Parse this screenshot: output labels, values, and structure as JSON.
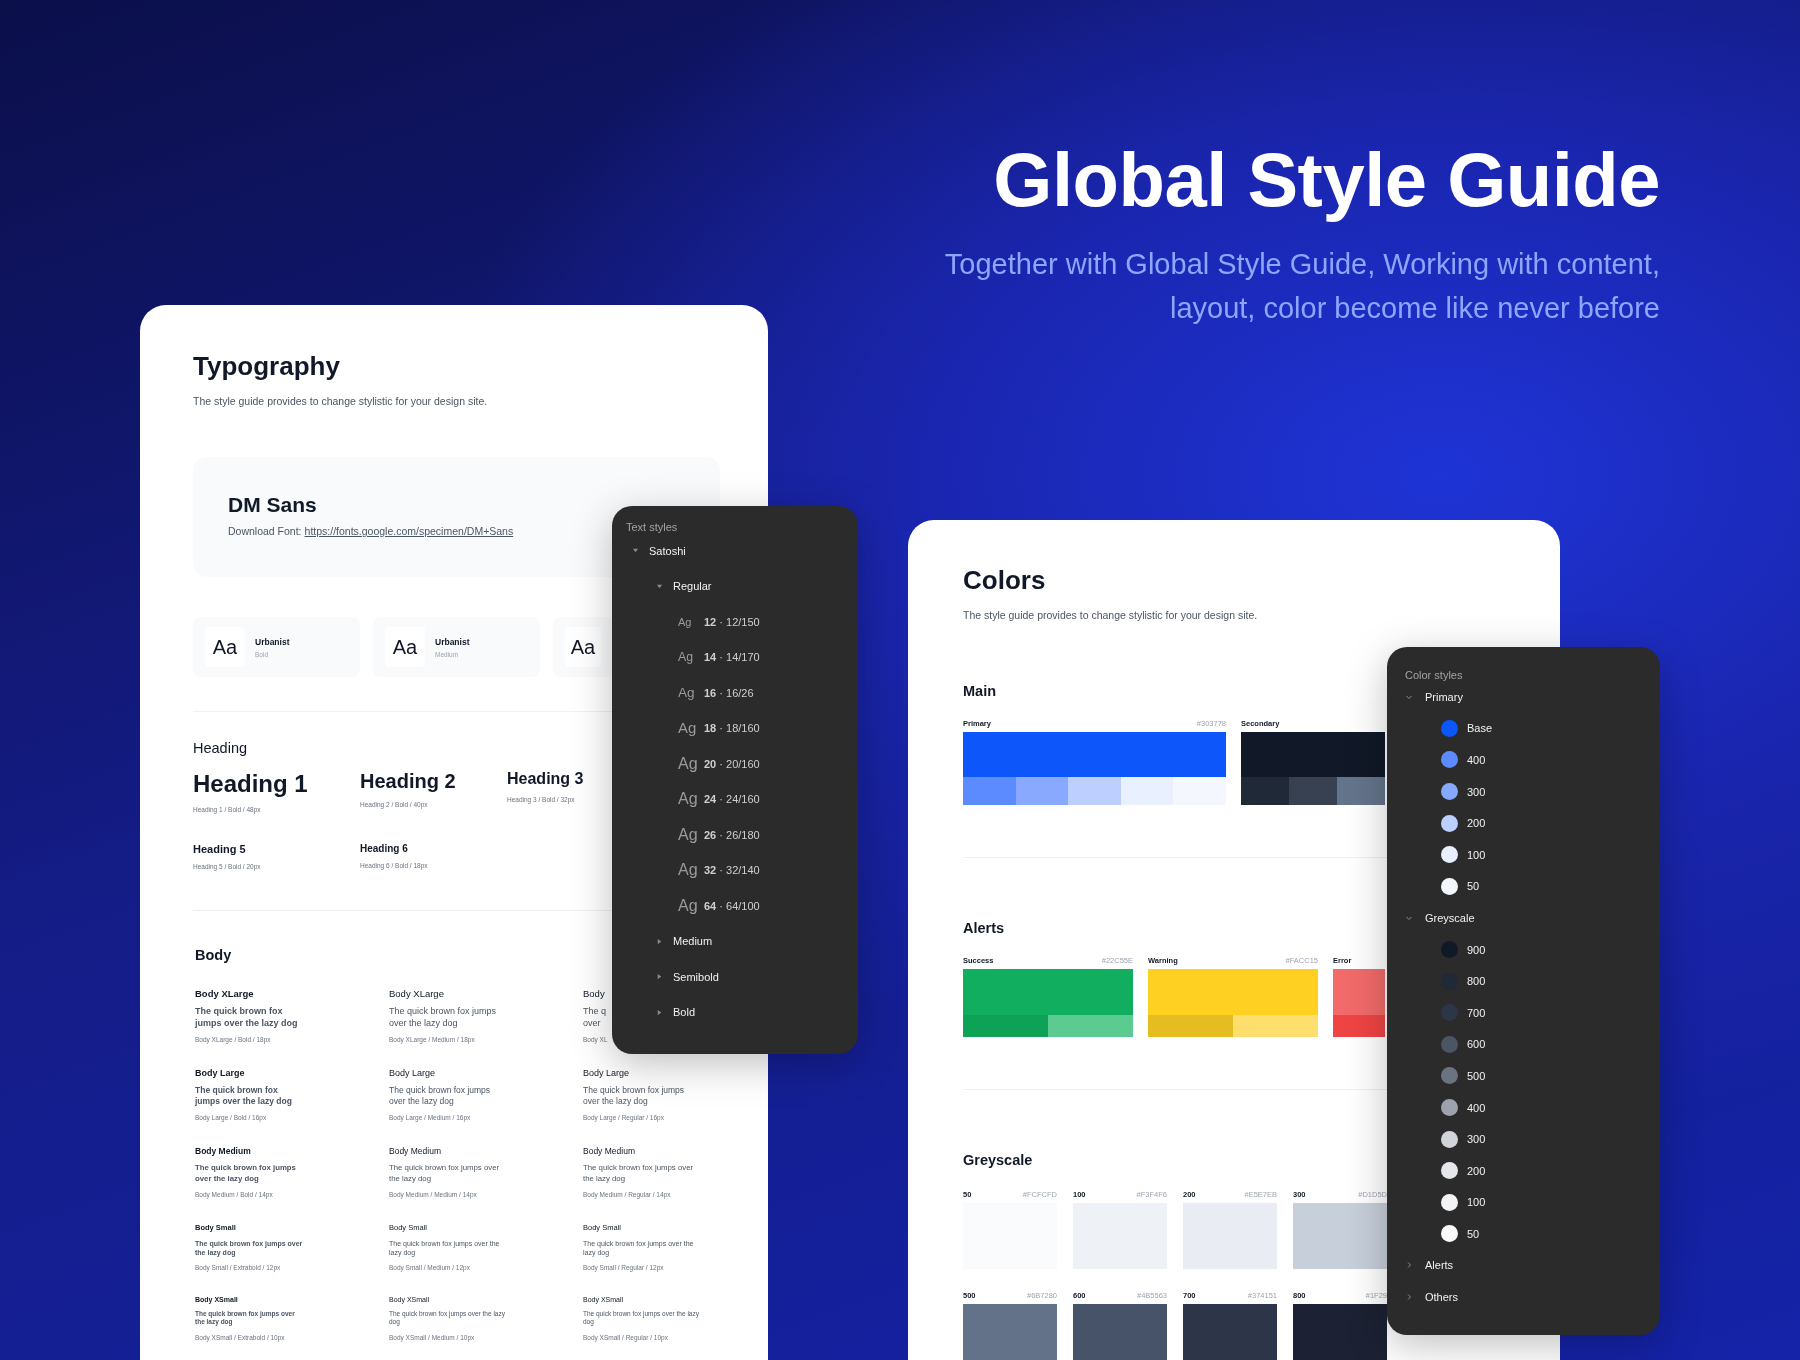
{
  "hero": {
    "title": "Global Style Guide",
    "subtitle_lines": [
      "Together with Global Style Guide, Working with content,",
      "layout, color become like never before"
    ]
  },
  "typography": {
    "title": "Typography",
    "description": "The style guide provides to change stylistic for your design site.",
    "font": {
      "name": "DM Sans",
      "download_label": "Download Font:",
      "link": "https://fonts.google.com/specimen/DM+Sans"
    },
    "font_tiles": [
      {
        "sample": "Aa",
        "family": "Urbanist",
        "weight": "Bold"
      },
      {
        "sample": "Aa",
        "family": "Urbanist",
        "weight": "Medium"
      },
      {
        "sample": "Aa"
      }
    ],
    "heading_section": {
      "title": "Heading",
      "rows": [
        [
          {
            "kind": "h1",
            "label": "Heading 1",
            "spec": "Heading 1 / Bold / 48px"
          },
          {
            "kind": "h2",
            "label": "Heading 2",
            "spec": "Heading 2 / Bold / 40px"
          },
          {
            "kind": "h3",
            "label": "Heading 3",
            "spec": "Heading 3 / Bold / 32px"
          }
        ],
        [
          {
            "kind": "h5",
            "label": "Heading 5",
            "spec": "Heading 5 / Bold / 20px"
          },
          {
            "kind": "h6",
            "label": "Heading 6",
            "spec": "Heading 6 / Bold / 18px"
          }
        ]
      ]
    },
    "body_section": {
      "title": "Body",
      "rows": [
        [
          {
            "kind": "xlarge",
            "label": "Body XLarge",
            "sample": "The quick brown fox jumps over the lazy dog",
            "spec": "Body XLarge / Bold / 18px"
          },
          {
            "kind": "xlarge",
            "label": "Body XLarge",
            "sample": "The quick brown fox jumps over the lazy dog",
            "spec": "Body XLarge / Medium / 18px"
          },
          {
            "kind": "xlarge",
            "label": "Body",
            "sample": "The q\nover",
            "spec": "Body XL"
          }
        ],
        [
          {
            "kind": "large",
            "label": "Body Large",
            "sample": "The quick brown fox jumps over the lazy dog",
            "spec": "Body Large / Bold / 16px"
          },
          {
            "kind": "large",
            "label": "Body Large",
            "sample": "The quick brown fox jumps over the lazy dog",
            "spec": "Body Large / Medium / 16px"
          },
          {
            "kind": "large",
            "label": "Body Large",
            "sample": "The quick brown fox jumps over the lazy dog",
            "spec": "Body Large / Regular / 16px"
          }
        ],
        [
          {
            "kind": "medium",
            "label": "Body Medium",
            "sample": "The quick brown fox jumps over the lazy dog",
            "spec": "Body Medium / Bold / 14px"
          },
          {
            "kind": "medium",
            "label": "Body Medium",
            "sample": "The quick brown fox jumps over the lazy dog",
            "spec": "Body Medium / Medium / 14px"
          },
          {
            "kind": "medium",
            "label": "Body Medium",
            "sample": "The quick brown fox jumps over the lazy dog",
            "spec": "Body Medium / Regular / 14px"
          }
        ],
        [
          {
            "kind": "small",
            "label": "Body Small",
            "sample": "The quick brown fox jumps over the lazy dog",
            "spec": "Body Small / Extrabold / 12px"
          },
          {
            "kind": "small",
            "label": "Body Small",
            "sample": "The quick brown fox jumps over the lazy dog",
            "spec": "Body Small / Medium / 12px"
          },
          {
            "kind": "small",
            "label": "Body Small",
            "sample": "The quick brown fox jumps over the lazy dog",
            "spec": "Body Small / Regular / 12px"
          }
        ],
        [
          {
            "kind": "xsmall",
            "label": "Body XSmall",
            "sample": "The quick brown fox jumps over the lazy dog",
            "spec": "Body XSmall / Extrabold / 10px"
          },
          {
            "kind": "xsmall",
            "label": "Body XSmall",
            "sample": "The quick brown fox jumps over the lazy dog",
            "spec": "Body XSmall / Medium / 10px"
          },
          {
            "kind": "xsmall",
            "label": "Body XSmall",
            "sample": "The quick brown fox jumps over the lazy dog",
            "spec": "Body XSmall / Regular / 10px"
          }
        ]
      ]
    }
  },
  "text_styles": {
    "title": "Text styles",
    "tree": [
      {
        "label": "Satoshi",
        "expanded": true,
        "children": [
          {
            "label": "Regular",
            "expanded": true,
            "children": [
              {
                "sample": "Ag",
                "label": "**12** · 12/150"
              },
              {
                "sample": "Ag",
                "label": "**14** · 14/170"
              },
              {
                "sample": "Ag",
                "label": "**16** · 16/26"
              },
              {
                "sample": "Ag",
                "label": "**18** · 18/160"
              },
              {
                "sample": "Ag",
                "label": "**20** · 20/160"
              },
              {
                "sample": "Ag",
                "label": "**24** · 24/160"
              },
              {
                "sample": "Ag",
                "label": "**26** · 26/180"
              },
              {
                "sample": "Ag",
                "label": "**32** · 32/140"
              },
              {
                "sample": "Ag",
                "label": "**64** · 64/100"
              }
            ]
          },
          {
            "label": "Medium",
            "expanded": false
          },
          {
            "label": "Semibold",
            "expanded": false
          },
          {
            "label": "Bold",
            "expanded": false
          }
        ]
      }
    ]
  },
  "colors": {
    "title": "Colors",
    "description": "The style guide provides to change stylistic for your design site.",
    "sections": [
      {
        "kind": "palette",
        "title": "Main",
        "swatches": [
          {
            "label": "Primary",
            "hex": "#303778",
            "color": "#0d56fa",
            "shades": [
              {
                "color": "#5b8bff"
              },
              {
                "color": "#88a9ff"
              },
              {
                "color": "#bccfff"
              },
              {
                "color": "#e9f0ff"
              },
              {
                "color": "#f5f7ff"
              }
            ]
          },
          {
            "label": "Secondary",
            "color": "#111827",
            "shades": [
              {
                "color": "#1f2937"
              },
              {
                "color": "#374151"
              },
              {
                "color": "#64748b"
              }
            ]
          }
        ]
      },
      {
        "kind": "palette",
        "title": "Alerts",
        "swatches": [
          {
            "label": "Success",
            "hex": "#22C55E",
            "color": "#10ae5e",
            "shades": [
              {
                "color": "#0ea257"
              },
              {
                "color": "#5ccb92"
              }
            ]
          },
          {
            "label": "Warning",
            "hex": "#FACC15",
            "color": "#fdd022",
            "shades": [
              {
                "color": "#e6bd20"
              },
              {
                "color": "#fedf6d"
              }
            ]
          },
          {
            "label": "Error",
            "color": "#f26a6a",
            "shades": [
              {
                "color": "#ef4444"
              }
            ]
          }
        ]
      },
      {
        "kind": "grid",
        "title": "Greyscale",
        "swatches": [
          {
            "label": "50",
            "hex": "#FCFCFD",
            "color": "#fafbfc"
          },
          {
            "label": "100",
            "hex": "#F3F4F6",
            "color": "#eef1f6"
          },
          {
            "label": "200",
            "hex": "#E5E7EB",
            "color": "#e9edf3"
          },
          {
            "label": "300",
            "hex": "#D1D5D",
            "color": "#c7cfda"
          },
          {
            "label": "500",
            "hex": "#6B7280",
            "color": "#637189"
          },
          {
            "label": "600",
            "hex": "#4B5563",
            "color": "#465368"
          },
          {
            "label": "700",
            "hex": "#374151",
            "color": "#2c3648"
          },
          {
            "label": "800",
            "hex": "#1F29",
            "color": "#1c2133"
          }
        ]
      }
    ]
  },
  "color_styles": {
    "title": "Color styles",
    "tree": [
      {
        "label": "Primary",
        "expanded": true,
        "children": [
          {
            "label": "Base",
            "color": "#0d56fa"
          },
          {
            "label": "400",
            "color": "#5b8bff"
          },
          {
            "label": "300",
            "color": "#86a8ff"
          },
          {
            "label": "200",
            "color": "#bcd0ff"
          },
          {
            "label": "100",
            "color": "#e8efff"
          },
          {
            "label": "50",
            "color": "#f5f7ff"
          }
        ]
      },
      {
        "label": "Greyscale",
        "expanded": true,
        "children": [
          {
            "label": "900",
            "color": "#111827"
          },
          {
            "label": "800",
            "color": "#1f2937"
          },
          {
            "label": "700",
            "color": "#2c3648"
          },
          {
            "label": "600",
            "color": "#4b5563"
          },
          {
            "label": "500",
            "color": "#6b7280"
          },
          {
            "label": "400",
            "color": "#9ca3af"
          },
          {
            "label": "300",
            "color": "#d1d5db"
          },
          {
            "label": "200",
            "color": "#e5e7eb"
          },
          {
            "label": "100",
            "color": "#f3f4f6"
          },
          {
            "label": "50",
            "color": "#fcfcfd"
          }
        ]
      },
      {
        "label": "Alerts",
        "expanded": false
      },
      {
        "label": "Others",
        "expanded": false
      }
    ]
  }
}
